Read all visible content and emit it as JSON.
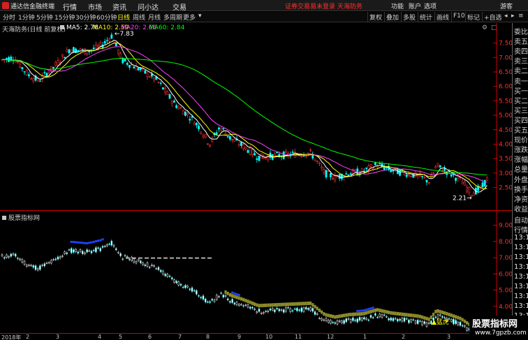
{
  "titlebar": {
    "app_name": "通达信金融终端",
    "menu": [
      "行情",
      "市场",
      "资讯",
      "问小达",
      "交易"
    ],
    "notice": "证券交易易未登录 天海防务",
    "right": [
      "功能",
      "账户",
      "选项",
      "游客"
    ]
  },
  "toolbar": {
    "periods": [
      "分时",
      "1分钟",
      "5分钟",
      "15分钟",
      "30分钟",
      "60分钟",
      "日线",
      "周线",
      "月线",
      "多周期",
      "更多"
    ],
    "active_period": "日线",
    "buttons": [
      "复权",
      "叠加",
      "多股",
      "统计",
      "画线",
      "F10",
      "标记",
      "+自选"
    ]
  },
  "main_chart": {
    "stock_label": "天海防务(日线 前复权)",
    "ma": [
      {
        "label": "MA5: 2.76",
        "color": "#ffffff"
      },
      {
        "label": "MA10: 2.59",
        "color": "#ffff00"
      },
      {
        "label": "MA20: 2.66",
        "color": "#ff40ff"
      },
      {
        "label": "MA60: 2.84",
        "color": "#00ff00"
      }
    ],
    "high_label": "7.83",
    "low_label": "2.21",
    "y_ticks": [
      "7.50",
      "7.00",
      "6.50",
      "6.00",
      "5.50",
      "5.00",
      "4.50",
      "4.00",
      "3.50",
      "3.00",
      "2.50"
    ]
  },
  "indicator_chart": {
    "title": "股票指标网",
    "y_ticks": [
      "9.00",
      "8.00",
      "7.00",
      "6.00",
      "5.00",
      "4.00",
      "3.00"
    ],
    "annotation": "猛虎"
  },
  "right_panel": {
    "top_items": [
      "委比",
      "卖五",
      "卖四",
      "卖三",
      "卖二",
      "卖一",
      "买一",
      "买二",
      "买三",
      "买四",
      "买五",
      "现价",
      "涨跌",
      "涨幅",
      "总量",
      "外盘",
      "换手",
      "净资",
      "收益"
    ],
    "bottom_items": [
      "自动",
      "行情",
      "13:1",
      "13:1",
      "13:1",
      "13:1",
      "13:1",
      "13:1",
      "13:1",
      "13:1",
      "13:1",
      "13:1",
      "13:1"
    ]
  },
  "date_axis": {
    "labels": [
      "2018年",
      "2",
      "3",
      "4",
      "5",
      "6",
      "7",
      "8",
      "9",
      "10",
      "11",
      "12",
      "1",
      "2",
      "3"
    ]
  },
  "watermark": {
    "line1": "股票指标网",
    "line2": "www.7gpzb.com"
  },
  "colors": {
    "up": "#ff3030",
    "down": "#00ffff",
    "ma5": "#ffffff",
    "ma10": "#ffff00",
    "ma20": "#ff40ff",
    "ma60": "#00ff00"
  }
}
